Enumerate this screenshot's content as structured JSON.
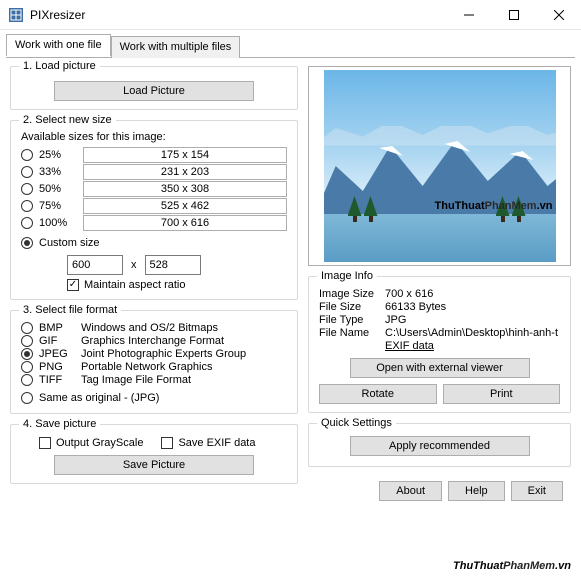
{
  "window": {
    "title": "PIXresizer"
  },
  "tabs": {
    "one": "Work with one file",
    "multi": "Work with multiple files"
  },
  "load": {
    "group": "1. Load picture",
    "btn": "Load Picture"
  },
  "size": {
    "group": "2. Select new size",
    "avail": "Available sizes for this image:",
    "rows": [
      {
        "pct": "25%",
        "dim": "175  x  154"
      },
      {
        "pct": "33%",
        "dim": "231  x  203"
      },
      {
        "pct": "50%",
        "dim": "350  x  308"
      },
      {
        "pct": "75%",
        "dim": "525  x  462"
      },
      {
        "pct": "100%",
        "dim": "700  x  616"
      }
    ],
    "custom": "Custom size",
    "w": "600",
    "x": "x",
    "h": "528",
    "aspect": "Maintain aspect ratio"
  },
  "fmt": {
    "group": "3. Select file format",
    "rows": [
      {
        "c": "BMP",
        "d": "Windows and OS/2 Bitmaps"
      },
      {
        "c": "GIF",
        "d": "Graphics Interchange Format"
      },
      {
        "c": "JPEG",
        "d": "Joint Photographic Experts Group"
      },
      {
        "c": "PNG",
        "d": "Portable Network Graphics"
      },
      {
        "c": "TIFF",
        "d": "Tag Image File Format"
      }
    ],
    "same": "Same as original  -  (JPG)"
  },
  "save": {
    "group": "4. Save picture",
    "gray": "Output GrayScale",
    "exif": "Save EXIF data",
    "btn": "Save Picture"
  },
  "info": {
    "group": "Image Info",
    "size_l": "Image Size",
    "size_v": "700 x 616",
    "fsize_l": "File Size",
    "fsize_v": "66133 Bytes",
    "ftype_l": "File Type",
    "ftype_v": "JPG",
    "fname_l": "File Name",
    "fname_v": "C:\\Users\\Admin\\Desktop\\hinh-anh-t",
    "exif": "EXIF data",
    "open": "Open with external viewer",
    "rotate": "Rotate",
    "print": "Print"
  },
  "quick": {
    "group": "Quick Settings",
    "apply": "Apply recommended"
  },
  "footer": {
    "about": "About",
    "help": "Help",
    "exit": "Exit"
  },
  "wm": {
    "a": "ThuThuat",
    "b": "PhanMem",
    "c": ".vn"
  }
}
